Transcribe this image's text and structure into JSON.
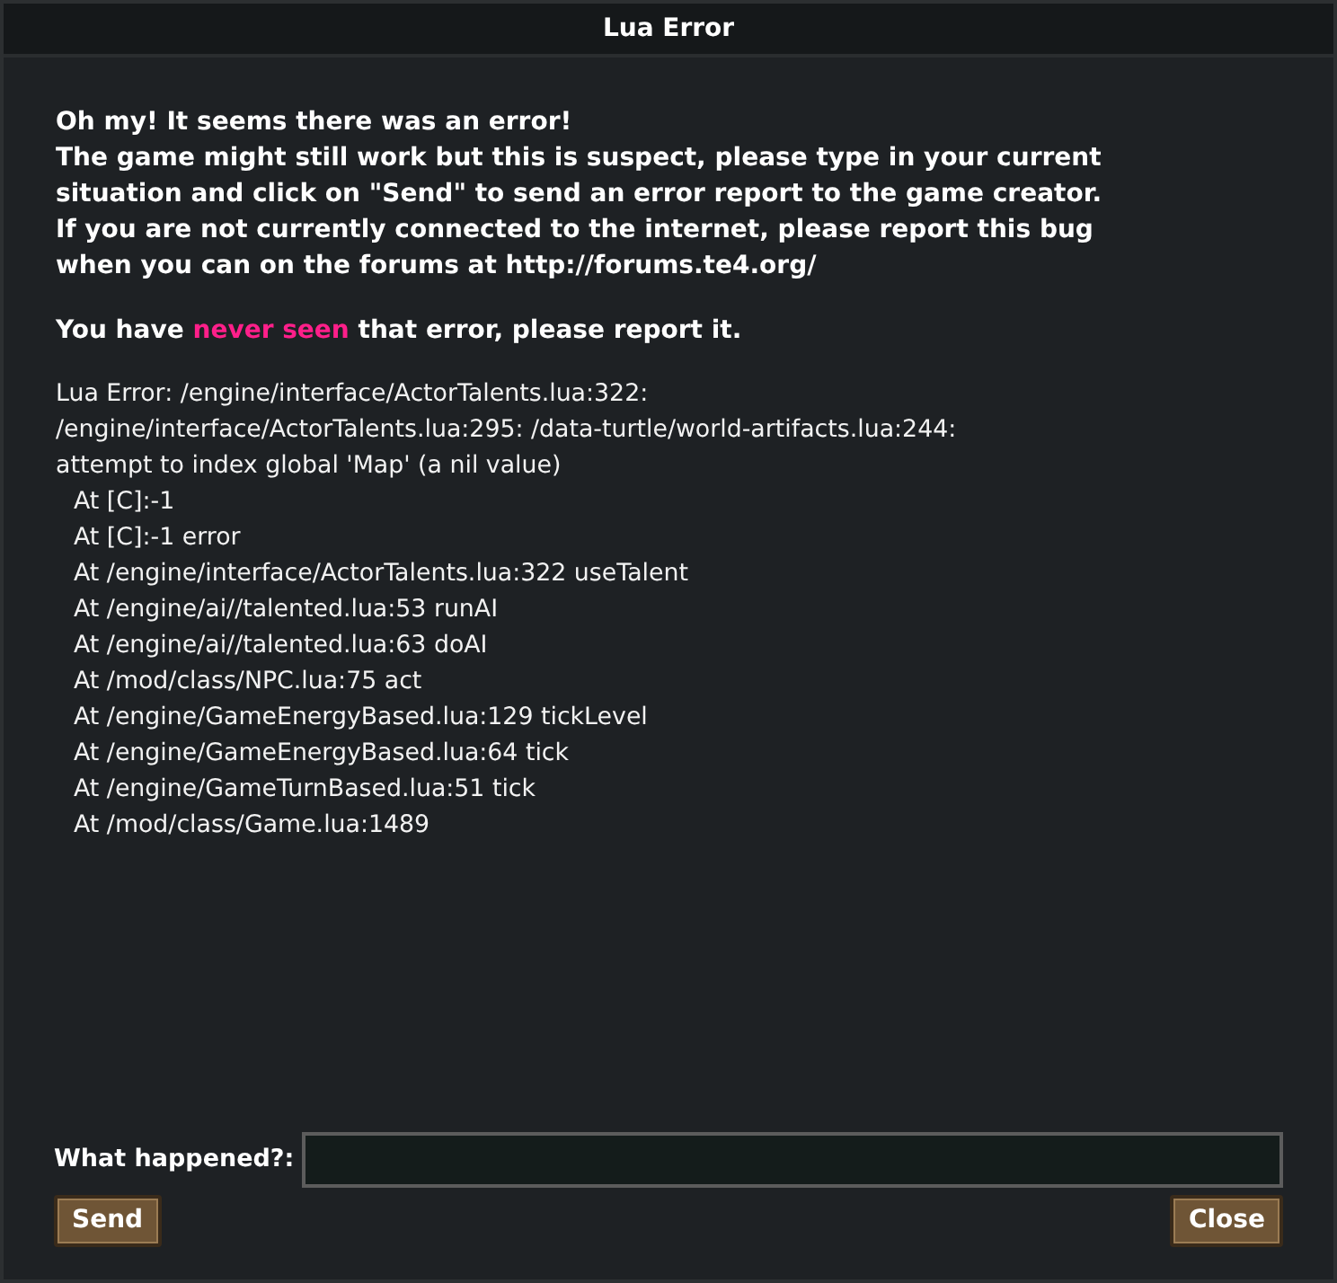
{
  "window": {
    "title": "Lua Error"
  },
  "intro_lines": [
    "Oh my! It seems there was an error!",
    "The game might still work but this is suspect, please type in your current",
    "situation and click on \"Send\" to send an error report to the game creator.",
    "If you are not currently connected to the internet, please report this bug",
    "when you can on the forums at http://forums.te4.org/"
  ],
  "seen_notice": {
    "before": "You have ",
    "highlight": "never seen",
    "after": " that error, please report it."
  },
  "error_lines": [
    "Lua Error: /engine/interface/ActorTalents.lua:322:",
    "/engine/interface/ActorTalents.lua:295: /data-turtle/world-artifacts.lua:244:",
    "attempt to index global 'Map' (a nil value)"
  ],
  "traceback": [
    "At [C]:-1",
    "At [C]:-1 error",
    "At /engine/interface/ActorTalents.lua:322 useTalent",
    "At /engine/ai//talented.lua:53 runAI",
    "At /engine/ai//talented.lua:63 doAI",
    "At /mod/class/NPC.lua:75 act",
    "At /engine/GameEnergyBased.lua:129 tickLevel",
    "At /engine/GameEnergyBased.lua:64 tick",
    "At /engine/GameTurnBased.lua:51 tick",
    "At /mod/class/Game.lua:1489"
  ],
  "report_field": {
    "label": "What happened?:"
  },
  "buttons": [
    "Send",
    "Close"
  ]
}
